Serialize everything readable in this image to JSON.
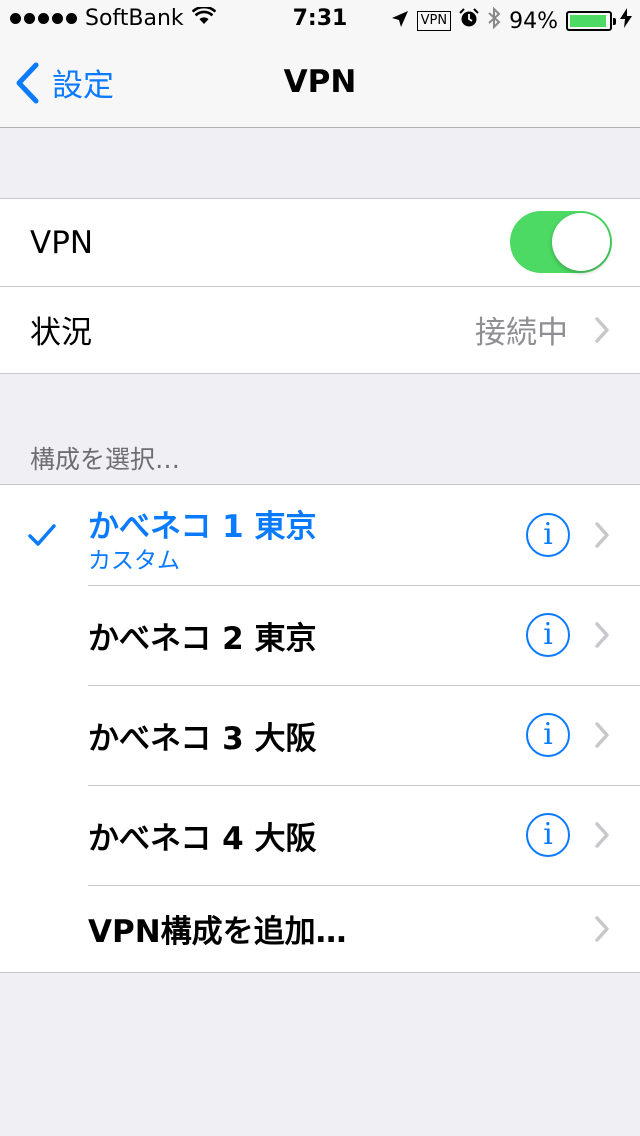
{
  "status_bar": {
    "carrier": "SoftBank",
    "time": "7:31",
    "vpn_badge": "VPN",
    "battery": "94%",
    "battery_level": 0.94
  },
  "nav": {
    "back_label": "設定",
    "title": "VPN"
  },
  "vpn_group": {
    "toggle_label": "VPN",
    "toggle_on": true,
    "status_label": "状況",
    "status_value": "接続中"
  },
  "section_header": "構成を選択…",
  "configs": [
    {
      "name": "かべネコ 1 東京",
      "subtitle": "カスタム",
      "selected": true
    },
    {
      "name": "かべネコ 2 東京",
      "selected": false
    },
    {
      "name": "かべネコ 3 大阪",
      "selected": false
    },
    {
      "name": "かべネコ 4 大阪",
      "selected": false
    }
  ],
  "add_config_label": "VPN構成を追加…",
  "colors": {
    "accent": "#0a7aff",
    "toggle_on": "#4cd964",
    "battery": "#4cd964"
  }
}
